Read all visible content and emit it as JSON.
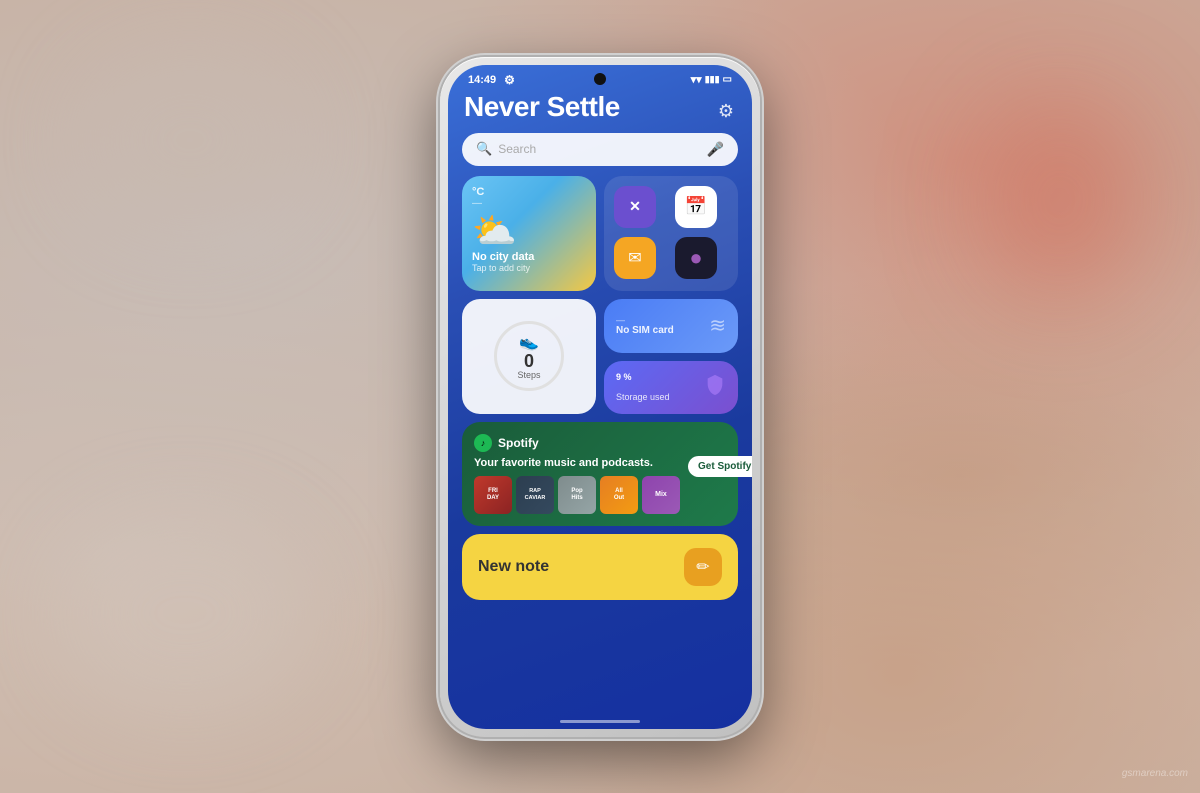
{
  "background": {
    "color": "#c8a898"
  },
  "phone": {
    "status_bar": {
      "time": "14:49",
      "settings_icon": "⚙",
      "wifi_icon": "wifi",
      "signal_icons": "▒▒",
      "battery_icon": "🔋"
    },
    "settings_gear": "⚙",
    "title": "Never Settle",
    "search": {
      "placeholder": "Search",
      "search_icon": "🔍",
      "mic_icon": "🎤"
    },
    "weather_widget": {
      "unit": "°C",
      "dash": "—",
      "cloud_emoji": "⛅",
      "city": "No city data",
      "tap_text": "Tap to add city"
    },
    "apps_widget": {
      "app1": {
        "icon": "✕",
        "bg": "calculator",
        "label": "Calculator"
      },
      "app2": {
        "icon": "📅",
        "bg": "calendar",
        "label": "Calendar"
      },
      "app3": {
        "icon": "✉",
        "bg": "gmail",
        "label": "Gmail"
      },
      "app4": {
        "icon": "●",
        "bg": "camera",
        "label": "Camera"
      }
    },
    "steps_widget": {
      "icon": "👟",
      "count": "0",
      "label": "Steps"
    },
    "sim_widget": {
      "dash": "—",
      "text": "No SIM card",
      "icon": "📶"
    },
    "storage_widget": {
      "percent": "9",
      "percent_symbol": "%",
      "label": "Storage used",
      "icon": "💾"
    },
    "spotify_widget": {
      "logo": "♪",
      "name": "Spotify",
      "tagline": "Your favorite music and podcasts.",
      "button_label": "Get Spotify free",
      "albums": [
        {
          "label": "FRI\nDAY",
          "style": "album-1"
        },
        {
          "label": "RAP\nCAVIAR",
          "style": "album-2"
        },
        {
          "label": "Pop\nHits",
          "style": "album-3"
        },
        {
          "label": "All\nOut",
          "style": "album-4"
        },
        {
          "label": "Mix",
          "style": "album-5"
        }
      ]
    },
    "new_note_widget": {
      "label": "New note",
      "edit_icon": "✏"
    },
    "home_indicator": true
  },
  "watermark": {
    "text": "gsmarena.com"
  }
}
